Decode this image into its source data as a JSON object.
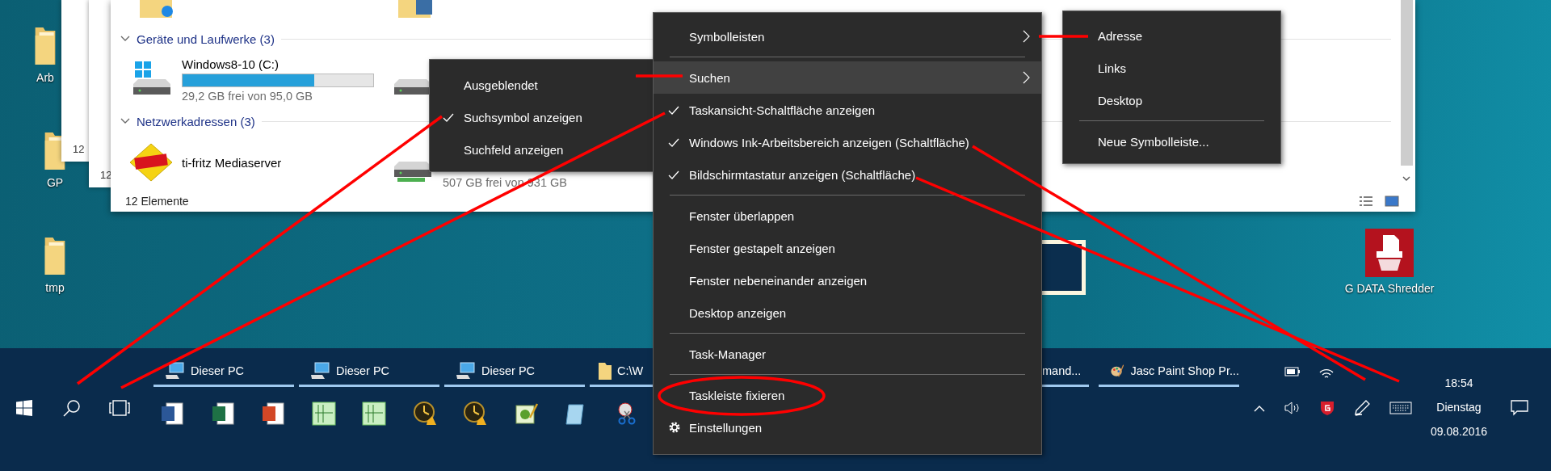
{
  "desktop_icons": [
    {
      "kind": "folder",
      "label": "Arb"
    },
    {
      "kind": "folder",
      "label": "GP"
    },
    {
      "kind": "folder",
      "label": "tmp"
    },
    {
      "kind": "shredder",
      "label": "G DATA Shredder"
    }
  ],
  "back_windows": [
    {
      "status": "12"
    },
    {
      "status": "12"
    }
  ],
  "explorer": {
    "sections": [
      {
        "title": "Geräte und Laufwerke (3)",
        "items": [
          {
            "kind": "system-drive",
            "name": "Windows8-10 (C:)",
            "level": 0.69,
            "free": "29,2 GB frei von 95,0 GB"
          },
          {
            "kind": "drive"
          }
        ]
      },
      {
        "title": "Netzwerkadressen (3)",
        "items": [
          {
            "kind": "server",
            "name": "ti-fritz Mediaserver"
          },
          {
            "kind": "network-drive",
            "free": "507 GB frei von 931 GB"
          }
        ]
      }
    ],
    "status": "12 Elemente"
  },
  "context_menu": {
    "items": [
      {
        "kind": "submenu",
        "label": "Symbolleisten",
        "selected": false
      },
      {
        "kind": "separator"
      },
      {
        "kind": "submenu",
        "label": "Suchen",
        "selected": true
      },
      {
        "kind": "check",
        "label": "Taskansicht-Schaltfläche anzeigen",
        "selected": false,
        "checked": true
      },
      {
        "kind": "check",
        "label": "Windows Ink-Arbeitsbereich anzeigen (Schaltfläche)",
        "selected": false,
        "checked": true
      },
      {
        "kind": "check",
        "label": "Bildschirmtastatur anzeigen (Schaltfläche)",
        "selected": false,
        "checked": true
      },
      {
        "kind": "separator"
      },
      {
        "kind": "item",
        "label": "Fenster überlappen",
        "selected": false
      },
      {
        "kind": "item",
        "label": "Fenster gestapelt anzeigen",
        "selected": false
      },
      {
        "kind": "item",
        "label": "Fenster nebeneinander anzeigen",
        "selected": false
      },
      {
        "kind": "item",
        "label": "Desktop anzeigen",
        "selected": false
      },
      {
        "kind": "separator"
      },
      {
        "kind": "item",
        "label": "Task-Manager",
        "selected": false
      },
      {
        "kind": "separator"
      },
      {
        "kind": "item",
        "label": "Taskleiste fixieren",
        "selected": false
      },
      {
        "kind": "settings",
        "label": "Einstellungen",
        "selected": false
      }
    ]
  },
  "search_submenu": {
    "items": [
      {
        "label": "Ausgeblendet",
        "checked": false
      },
      {
        "label": "Suchsymbol anzeigen",
        "checked": true
      },
      {
        "label": "Suchfeld anzeigen",
        "checked": false
      }
    ]
  },
  "toolbars_submenu": {
    "items": [
      {
        "kind": "item",
        "label": "Adresse"
      },
      {
        "kind": "item",
        "label": "Links"
      },
      {
        "kind": "item",
        "label": "Desktop"
      },
      {
        "kind": "separator"
      },
      {
        "kind": "item",
        "label": "Neue Symbolleiste..."
      }
    ]
  },
  "taskbar": {
    "tasks": [
      {
        "kind": "pc",
        "label": "Dieser PC"
      },
      {
        "kind": "pc",
        "label": "Dieser PC"
      },
      {
        "kind": "pc",
        "label": "Dieser PC"
      },
      {
        "kind": "folder",
        "label": "C:\\W"
      },
      {
        "kind": "cut",
        "label": "mand..."
      },
      {
        "kind": "paint",
        "label": "Jasc Paint Shop Pr..."
      }
    ],
    "pinned": [
      {
        "kind": "word"
      },
      {
        "kind": "excel"
      },
      {
        "kind": "powerpoint"
      },
      {
        "kind": "chart"
      },
      {
        "kind": "chart"
      },
      {
        "kind": "clock"
      },
      {
        "kind": "clock"
      },
      {
        "kind": "editor"
      },
      {
        "kind": "notepad"
      },
      {
        "kind": "scissors"
      }
    ],
    "time": "18:54",
    "day": "Dienstag",
    "date": "09.08.2016"
  }
}
